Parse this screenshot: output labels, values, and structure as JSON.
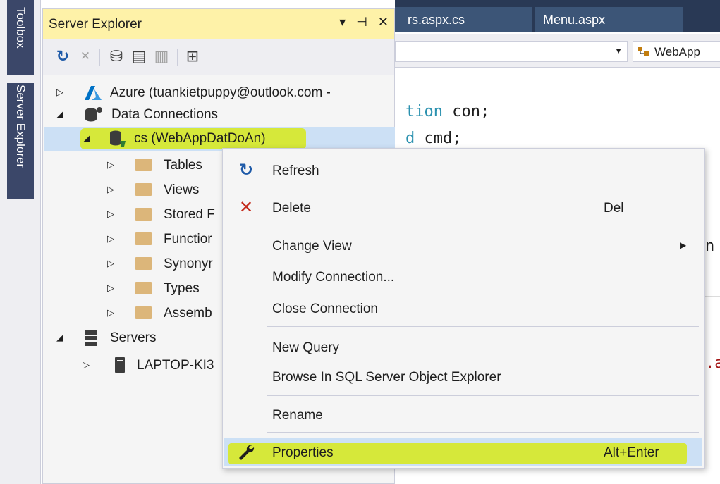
{
  "side_strip": {
    "toolbox_label": "Toolbox",
    "server_explorer_label": "Server Explorer"
  },
  "editor": {
    "tabs": [
      {
        "label": "rs.aspx.cs"
      },
      {
        "label": "Menu.aspx"
      }
    ],
    "nav_right_text": "WebApp",
    "code": {
      "line1_kw": "tion",
      "line1_rest": " con;",
      "line2_kw": "d",
      "line2_rest": " cmd;",
      "fragment3": "n",
      "fragment4": ".a"
    }
  },
  "server_explorer": {
    "title": "Server Explorer",
    "title_buttons": {
      "dropdown": "▾",
      "pin": "⊣",
      "close": "✕"
    },
    "toolbar": {
      "refresh": "↻",
      "stop": "✕",
      "connect_database": "⛁",
      "connect_server": "▤",
      "connect_sharepoint": "▥",
      "filter": "⊞"
    },
    "tree": {
      "azure": {
        "label": "Azure (tuankietpuppy@outlook.com -"
      },
      "data_connections": {
        "label": "Data Connections"
      },
      "connection": {
        "label": "cs (WebAppDatDoAn)"
      },
      "folders": [
        "Tables",
        "Views",
        "Stored F",
        "Functior",
        "Synonyr",
        "Types",
        "Assemb"
      ],
      "servers": {
        "label": "Servers"
      },
      "laptop": {
        "label": "LAPTOP-KI3"
      }
    }
  },
  "context_menu": {
    "items": [
      {
        "label": "Refresh",
        "icon": "refresh-icon",
        "glyph": "↻"
      },
      {
        "label": "Delete",
        "shortcut": "Del",
        "icon": "delete-icon",
        "glyph": "✕"
      },
      {
        "label": "Change View",
        "submenu": true,
        "arrow": "▶"
      },
      {
        "label": "Modify Connection..."
      },
      {
        "label": "Close Connection"
      },
      {
        "label": "New Query"
      },
      {
        "label": "Browse In SQL Server Object Explorer"
      },
      {
        "label": "Rename"
      },
      {
        "label": "Properties",
        "shortcut": "Alt+Enter",
        "icon": "wrench-icon"
      }
    ]
  },
  "colors": {
    "title_bar_active": "#fef2a8",
    "editor_tab_strip": "#293955",
    "editor_tab": "#3c5577",
    "selection": "#cce0f5",
    "user_highlight_marker": "#d6e83a",
    "azure_blue": "#0072c6",
    "delete_red": "#c42b1c",
    "refresh_blue": "#1e5aa8"
  }
}
